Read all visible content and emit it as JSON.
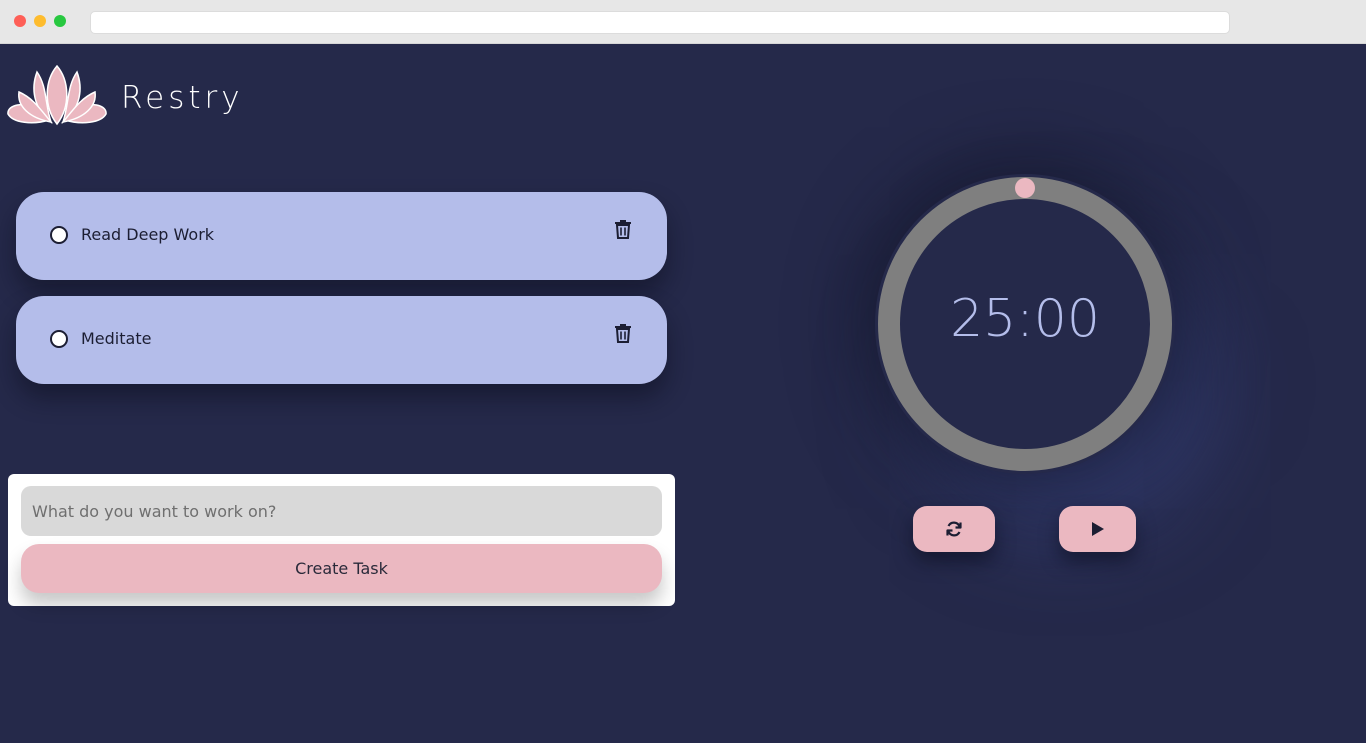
{
  "brand": {
    "name": "Restry",
    "logo_icon": "lotus-icon"
  },
  "tasks": [
    {
      "label": "Read Deep Work",
      "done": false
    },
    {
      "label": "Meditate",
      "done": false
    }
  ],
  "form": {
    "placeholder": "What do you want to work on?",
    "value": "",
    "create_label": "Create Task"
  },
  "timer": {
    "display": "25:00",
    "progress": 0
  },
  "controls": {
    "reset_icon": "refresh-icon",
    "play_icon": "play-icon"
  },
  "colors": {
    "background": "#25294a",
    "task_card": "#b4bdea",
    "accent_pink": "#ebb8c1",
    "ring": "#7f7f7f",
    "timer_text": "#b4bdea"
  }
}
